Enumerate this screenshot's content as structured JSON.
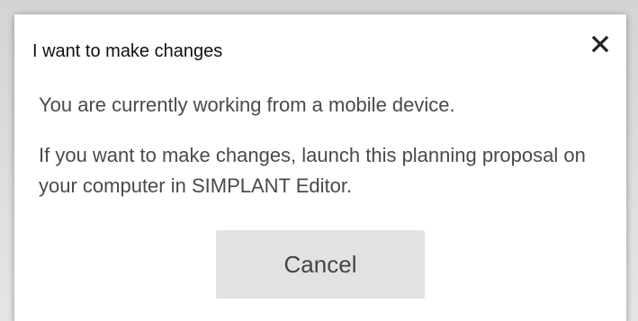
{
  "dialog": {
    "title": "I want to make changes",
    "close_icon": "close-icon",
    "message_1": "You are currently working from a mobile device.",
    "message_2": "If you want to make changes, launch this planning proposal on your computer in SIMPLANT Editor.",
    "cancel_label": "Cancel"
  },
  "colors": {
    "title": "#111111",
    "text": "#4a4a4a",
    "button_bg": "#e2e2e2",
    "dialog_bg": "#ffffff"
  }
}
